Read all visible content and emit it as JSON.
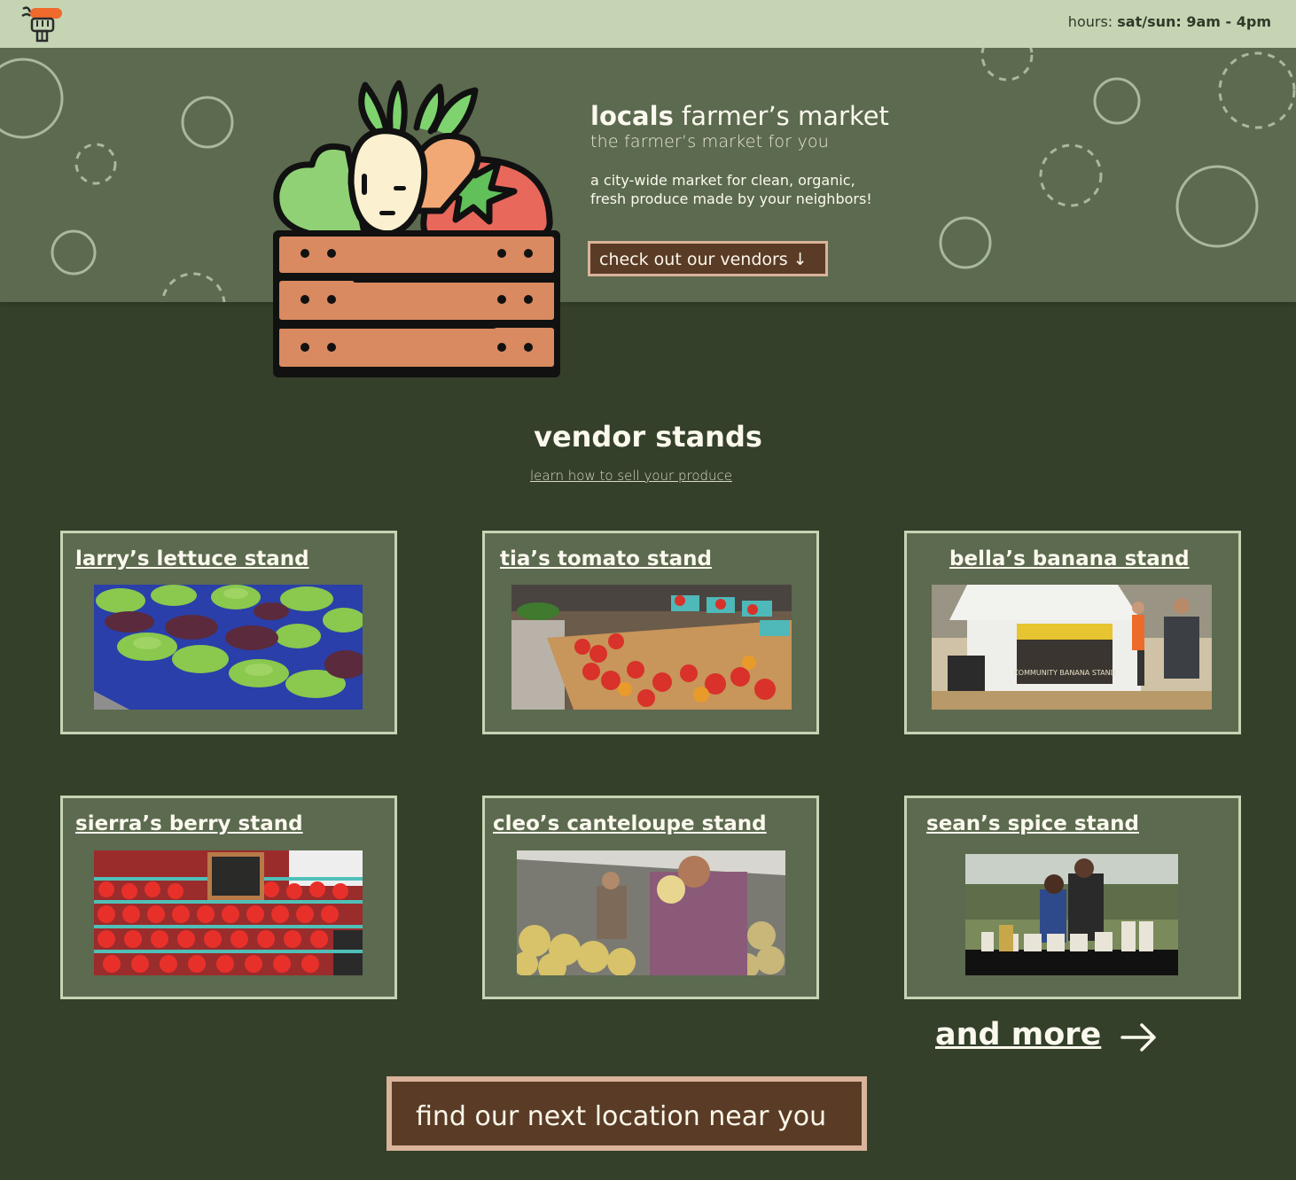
{
  "header": {
    "logo_icon": "veggie-crate-logo-icon",
    "hours_prefix": "hours: ",
    "hours_value": "sat/sun: 9am - 4pm"
  },
  "hero": {
    "title_bold": "locals",
    "title_rest": " farmer’s market",
    "subtitle": "the farmer’s market for you",
    "description": "a city-wide market for clean, organic, fresh produce made by your neighbors!",
    "cta_label": "check out our vendors ↓"
  },
  "vendors": {
    "title": "vendor stands",
    "link": "learn how to sell your produce",
    "items": [
      {
        "name": "larry’s lettuce stand"
      },
      {
        "name": "tia’s tomato stand"
      },
      {
        "name": "bella’s banana stand"
      },
      {
        "name": "sierra’s berry stand"
      },
      {
        "name": "cleo’s canteloupe stand"
      },
      {
        "name": "sean’s spice stand"
      }
    ],
    "banana_sign": "COMMUNITY BANANA STAND",
    "more_label": "and more"
  },
  "footer_cta": {
    "label": "find our next location near you"
  },
  "colors": {
    "page_bg": "#34402a",
    "header_bg": "#c5d5b4",
    "hero_bg": "#5c6a4f",
    "button_bg": "#5a3c26",
    "button_border": "#d9b39a"
  }
}
